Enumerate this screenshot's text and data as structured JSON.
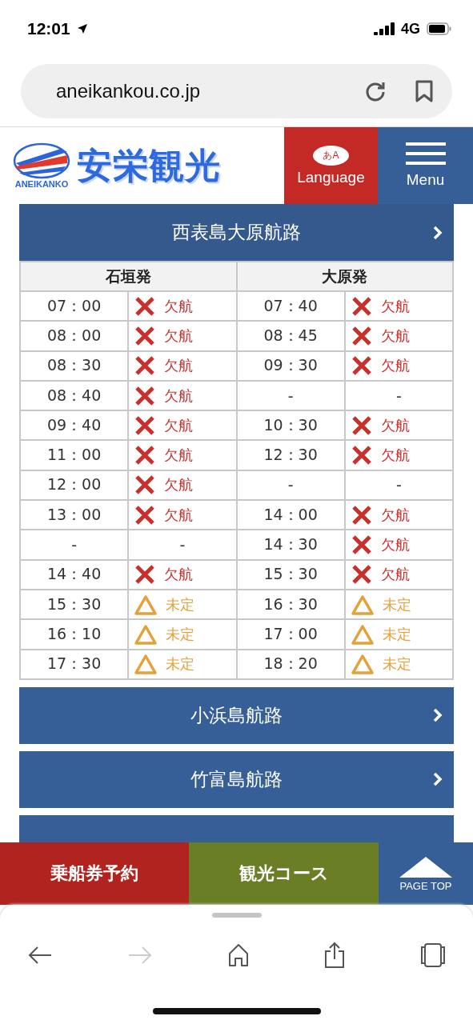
{
  "status_bar": {
    "time": "12:01",
    "network": "4G"
  },
  "browser": {
    "url": "aneikankou.co.jp"
  },
  "header": {
    "logo_text": "ANEIKANKO",
    "brand": "安栄観光",
    "language_icon_text": "あA",
    "language_label": "Language",
    "menu_label": "Menu"
  },
  "route": {
    "title": "西表島大原航路",
    "expanded": true,
    "columns": [
      "石垣発",
      "大原発"
    ],
    "rows": [
      {
        "left": {
          "time": "07：00",
          "kind": "cancelled",
          "label": "欠航"
        },
        "right": {
          "time": "07：40",
          "kind": "cancelled",
          "label": "欠航"
        }
      },
      {
        "left": {
          "time": "08：00",
          "kind": "cancelled",
          "label": "欠航"
        },
        "right": {
          "time": "08：45",
          "kind": "cancelled",
          "label": "欠航"
        }
      },
      {
        "left": {
          "time": "08：30",
          "kind": "cancelled",
          "label": "欠航"
        },
        "right": {
          "time": "09：30",
          "kind": "cancelled",
          "label": "欠航"
        }
      },
      {
        "left": {
          "time": "08：40",
          "kind": "cancelled",
          "label": "欠航"
        },
        "right": {
          "time": "-",
          "kind": "none",
          "label": "-"
        }
      },
      {
        "left": {
          "time": "09：40",
          "kind": "cancelled",
          "label": "欠航"
        },
        "right": {
          "time": "10：30",
          "kind": "cancelled",
          "label": "欠航"
        }
      },
      {
        "left": {
          "time": "11：00",
          "kind": "cancelled",
          "label": "欠航"
        },
        "right": {
          "time": "12：30",
          "kind": "cancelled",
          "label": "欠航"
        }
      },
      {
        "left": {
          "time": "12：00",
          "kind": "cancelled",
          "label": "欠航"
        },
        "right": {
          "time": "-",
          "kind": "none",
          "label": "-"
        }
      },
      {
        "left": {
          "time": "13：00",
          "kind": "cancelled",
          "label": "欠航"
        },
        "right": {
          "time": "14：00",
          "kind": "cancelled",
          "label": "欠航"
        }
      },
      {
        "left": {
          "time": "-",
          "kind": "none",
          "label": "-"
        },
        "right": {
          "time": "14：30",
          "kind": "cancelled",
          "label": "欠航"
        }
      },
      {
        "left": {
          "time": "14：40",
          "kind": "cancelled",
          "label": "欠航"
        },
        "right": {
          "time": "15：30",
          "kind": "cancelled",
          "label": "欠航"
        }
      },
      {
        "left": {
          "time": "15：30",
          "kind": "undecided",
          "label": "未定"
        },
        "right": {
          "time": "16：30",
          "kind": "undecided",
          "label": "未定"
        }
      },
      {
        "left": {
          "time": "16：10",
          "kind": "undecided",
          "label": "未定"
        },
        "right": {
          "time": "17：00",
          "kind": "undecided",
          "label": "未定"
        }
      },
      {
        "left": {
          "time": "17：30",
          "kind": "undecided",
          "label": "未定"
        },
        "right": {
          "time": "18：20",
          "kind": "undecided",
          "label": "未定"
        }
      }
    ]
  },
  "other_routes": [
    {
      "title": "小浜島航路",
      "expanded": false
    },
    {
      "title": "竹富島航路",
      "expanded": false
    },
    {
      "expanded": false
    }
  ],
  "action_bar": {
    "booking": "乗船券予約",
    "tours": "観光コース",
    "page_top": "PAGE TOP"
  }
}
